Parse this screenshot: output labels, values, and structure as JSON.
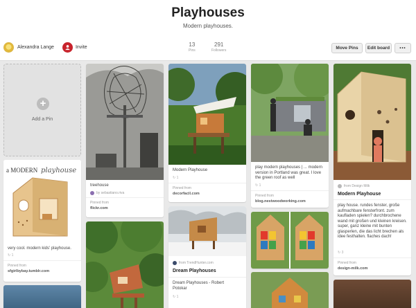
{
  "board": {
    "title": "Playhouses",
    "description": "Modern playhouses.",
    "owner_name": "Alexandra Lange",
    "invite_label": "Invite",
    "stats": [
      {
        "value": "13",
        "label": "Pins"
      },
      {
        "value": "291",
        "label": "Followers"
      }
    ],
    "buttons": {
      "move_pins": "Move Pins",
      "edit_board": "Edit board",
      "more": "•••"
    }
  },
  "add_pin": {
    "label": "Add a Pin",
    "icon": "plus-icon"
  },
  "pins": [
    {
      "id": "treehouse",
      "description": "treehouse",
      "attribution": "by sebastiano.riva",
      "pinned_from": "Pinned from",
      "source": "flickr.com"
    },
    {
      "id": "modern-playhouse",
      "description": "Modern Playhouse",
      "repins": "↻ 1",
      "pinned_from": "Pinned from",
      "source": "decorfacil.com"
    },
    {
      "id": "portland",
      "description": "play modern playhouses | ... modern version in Portland was great. I love the green roof as well",
      "repins": "↻ 1",
      "pinned_from": "Pinned from",
      "source": "blog.nestwoodworking.com"
    },
    {
      "id": "design-milk",
      "from_label": "from Design Milk",
      "title": "Modern Playhouse",
      "description": "play house. rundes fenster, große aufmachbare fensterfront. zum kaufladen spielen? durchbrochene wand mit großen und kleinen kreisen. super, ganz kleine mit bunten glasperlen, die das licht brechen als idee festhalten. flaches dach!",
      "repins": "↻ 3",
      "pinned_from": "Pinned from",
      "source": "design-milk.com"
    },
    {
      "id": "kids-playhouse",
      "image_text": "a MODERN playhouse",
      "description": "very cool. modern kids' playhouse.",
      "repins": "↻ 1",
      "pinned_from": "Pinned from",
      "source": "sfgirlbybay.tumblr.com"
    },
    {
      "id": "dream",
      "from_label": "from TrendHunter.com",
      "title": "Dream Playhouses",
      "description": "Dream Playhouses - Robert Potokar",
      "repins": "↻ 1"
    }
  ],
  "colors": {
    "pinterest_red": "#c8232c",
    "background": "#e9e9e9"
  }
}
